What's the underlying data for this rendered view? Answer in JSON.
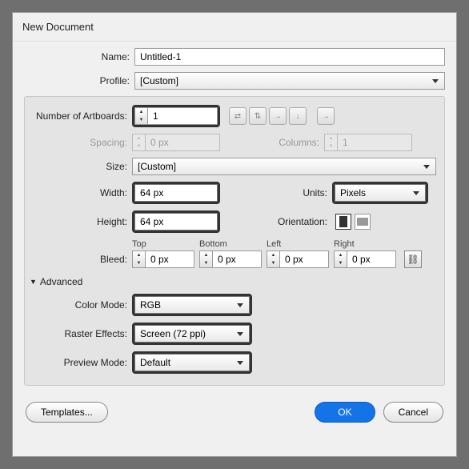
{
  "dialog": {
    "title": "New Document"
  },
  "name": {
    "label": "Name:",
    "value": "Untitled-1"
  },
  "profile": {
    "label": "Profile:",
    "value": "[Custom]"
  },
  "artboards": {
    "numberLabel": "Number of Artboards:",
    "numberValue": "1",
    "spacingLabel": "Spacing:",
    "spacingValue": "0 px",
    "columnsLabel": "Columns:",
    "columnsValue": "1"
  },
  "size": {
    "label": "Size:",
    "value": "[Custom]"
  },
  "width": {
    "label": "Width:",
    "value": "64 px"
  },
  "height": {
    "label": "Height:",
    "value": "64 px"
  },
  "units": {
    "label": "Units:",
    "value": "Pixels"
  },
  "orientation": {
    "label": "Orientation:"
  },
  "bleed": {
    "label": "Bleed:",
    "topLabel": "Top",
    "topValue": "0 px",
    "bottomLabel": "Bottom",
    "bottomValue": "0 px",
    "leftLabel": "Left",
    "leftValue": "0 px",
    "rightLabel": "Right",
    "rightValue": "0 px"
  },
  "advanced": {
    "label": "Advanced"
  },
  "colorMode": {
    "label": "Color Mode:",
    "value": "RGB"
  },
  "rasterEffects": {
    "label": "Raster Effects:",
    "value": "Screen (72 ppi)"
  },
  "previewMode": {
    "label": "Preview Mode:",
    "value": "Default"
  },
  "footer": {
    "templates": "Templates...",
    "ok": "OK",
    "cancel": "Cancel"
  }
}
